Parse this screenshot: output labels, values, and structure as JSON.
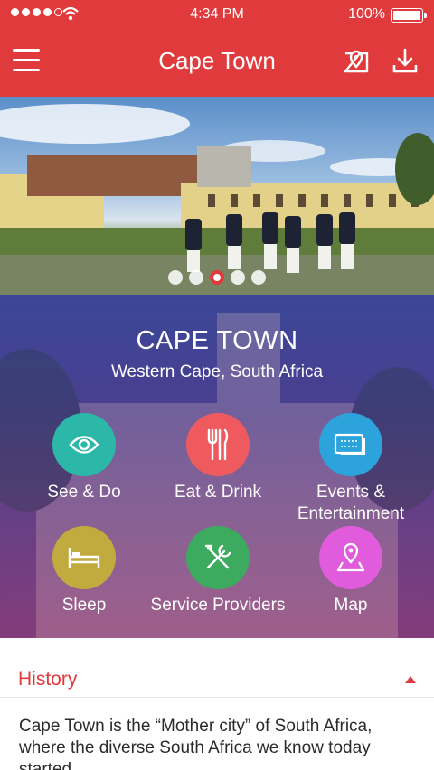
{
  "status_bar": {
    "time": "4:34 PM",
    "battery": "100%"
  },
  "nav": {
    "title": "Cape Town"
  },
  "carousel": {
    "slide_count": 5,
    "active_index": 2
  },
  "city": {
    "name": "CAPE TOWN",
    "region": "Western Cape, South Africa"
  },
  "categories": [
    {
      "label": "See & Do",
      "color": "#2cb8a8",
      "icon": "eye-icon"
    },
    {
      "label": "Eat & Drink",
      "color": "#ef5a5f",
      "icon": "cutlery-icon"
    },
    {
      "label": "Events & Entertainment",
      "color": "#2da3dc",
      "icon": "ticket-icon"
    },
    {
      "label": "Sleep",
      "color": "#c2ab3e",
      "icon": "bed-icon"
    },
    {
      "label": "Service Providers",
      "color": "#3dab5f",
      "icon": "tools-icon"
    },
    {
      "label": "Map",
      "color": "#e05cdc",
      "icon": "map-pin-icon"
    }
  ],
  "history": {
    "title": "History",
    "text": "Cape Town is the “Mother city” of South Africa, where the diverse South Africa we know today started"
  },
  "colors": {
    "brand_red": "#e03a3c"
  }
}
